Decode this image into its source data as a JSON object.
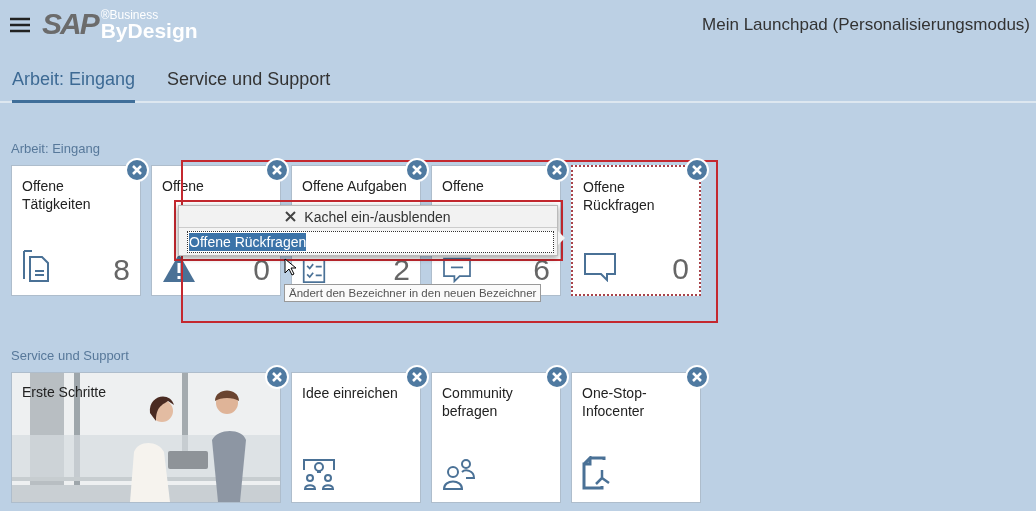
{
  "header": {
    "logo": {
      "brand": "SAP",
      "superscript": "®Business",
      "product": "ByDesign"
    },
    "title": "Mein Launchpad (Personalisierungsmodus)"
  },
  "tabs": [
    {
      "label": "Arbeit: Eingang",
      "selected": true
    },
    {
      "label": "Service und Support",
      "selected": false
    }
  ],
  "sections": [
    {
      "title": "Arbeit: Eingang",
      "tiles": [
        {
          "kind": "count",
          "title": "Offene Tätigkeiten",
          "count": "8",
          "selected": false
        },
        {
          "kind": "count",
          "title": "Offene",
          "count": "0",
          "selected": false
        },
        {
          "kind": "count",
          "title": "Offene Aufgaben",
          "count": "2",
          "selected": false
        },
        {
          "kind": "count",
          "title": "Offene",
          "count": "6",
          "selected": false
        },
        {
          "kind": "count",
          "title": "Offene Rückfragen",
          "count": "0",
          "selected": true
        }
      ]
    },
    {
      "title": "Service und Support",
      "tiles": [
        {
          "kind": "picture",
          "title": "Erste Schritte",
          "selected": false
        },
        {
          "kind": "link",
          "title": "Idee einreichen",
          "selected": false
        },
        {
          "kind": "link",
          "title": "Community befragen",
          "selected": false
        },
        {
          "kind": "link",
          "title": "One-Stop-Infocenter",
          "selected": false
        }
      ]
    }
  ],
  "rename_popup": {
    "toggle_label": "Kachel ein-/ausblenden",
    "value": "Offene Rückfragen",
    "tooltip": "Ändert den Bezeichner in den neuen Bezeichner"
  }
}
